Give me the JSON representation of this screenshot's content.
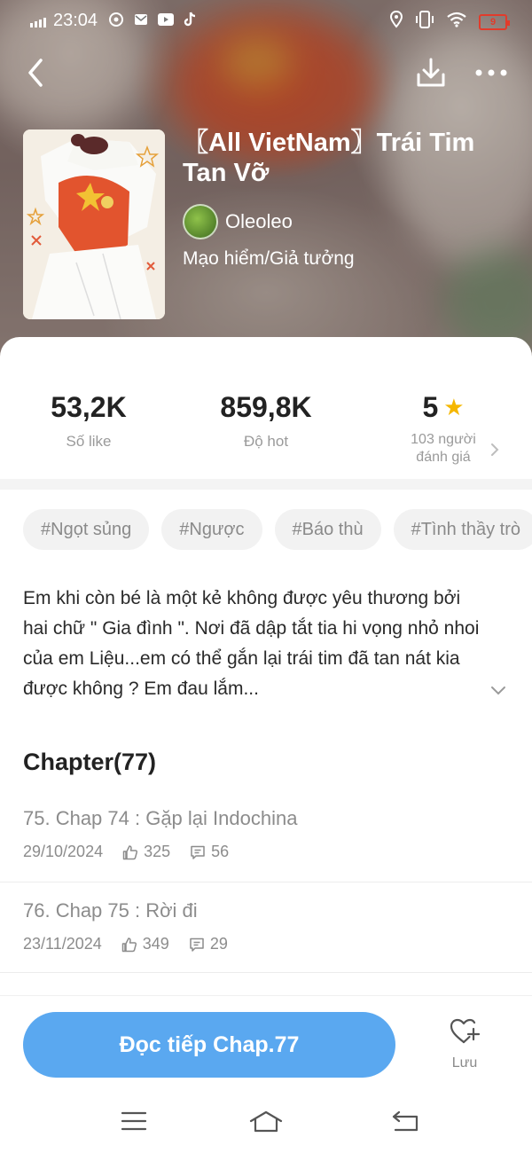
{
  "status_bar": {
    "time": "23:04",
    "battery": "9"
  },
  "story": {
    "title": "〖All VietNam〗Trái Tim Tan Vỡ",
    "author": "Oleoleo",
    "genre": "Mạo hiểm/Giả tưởng"
  },
  "stats": {
    "likes_value": "53,2K",
    "likes_label": "Số like",
    "hot_value": "859,8K",
    "hot_label": "Độ hot",
    "rating_value": "5",
    "rating_label_1": "103 người",
    "rating_label_2": "đánh giá"
  },
  "tags": [
    "#Ngọt sủng",
    "#Ngược",
    "#Báo thù",
    "#Tình thầy trò"
  ],
  "description": "Em khi còn bé là một kẻ không được yêu thương bởi hai chữ \" Gia đình \". Nơi đã dập tắt tia hi vọng nhỏ nhoi của em  Liệu...em có thể gắn lại trái tim đã tan nát kia được không ?  Em đau lắm...",
  "chapters_header": "Chapter(77)",
  "chapters": [
    {
      "title": "75. Chap 74 : Gặp lại Indochina",
      "date": "29/10/2024",
      "likes": "325",
      "comments": "56"
    },
    {
      "title": "76. Chap 75 : Rời đi",
      "date": "23/11/2024",
      "likes": "349",
      "comments": "29"
    }
  ],
  "actions": {
    "read_button": "Đọc tiếp Chap.77",
    "save_label": "Lưu"
  },
  "colors": {
    "accent": "#5aa8f0",
    "star": "#f5b700"
  }
}
